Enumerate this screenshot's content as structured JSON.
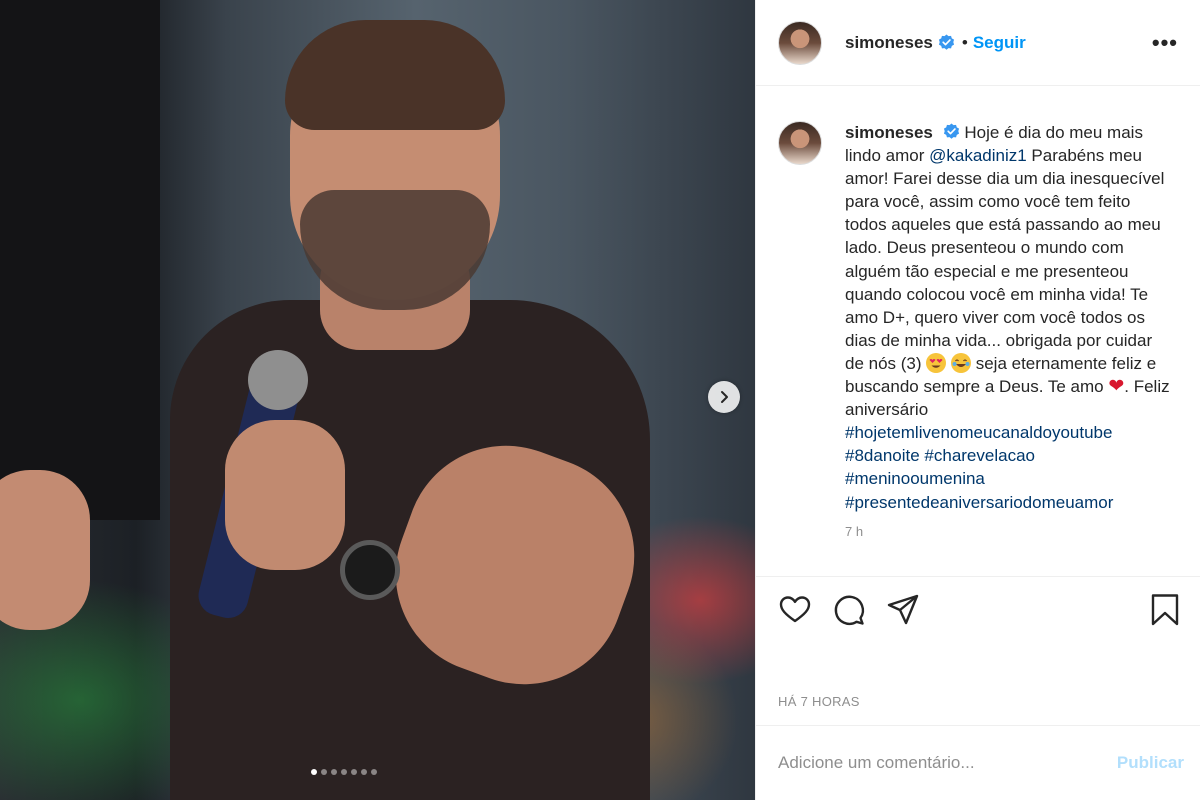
{
  "header": {
    "username": "simoneses",
    "separator": "•",
    "follow_label": "Seguir",
    "more_label": "•••"
  },
  "caption": {
    "username": "simoneses",
    "text_1": "Hoje é dia do meu mais lindo amor ",
    "mention": "@kakadiniz1",
    "text_2": " Parabéns meu amor! Farei desse dia um dia inesquecível para você, assim como você tem feito todos aqueles que está passando ao meu lado. Deus presenteou o mundo com alguém tão especial e me presenteou quando colocou você em minha vida! Te amo D+, quero viver com você todos os dias de minha vida... obrigada por cuidar de nós (3) ",
    "text_3": " seja eternamente feliz e buscando sempre a Deus. Te amo ",
    "text_4": ". Feliz aniversário",
    "hashtags": [
      "#hojetemlivenomeucanaldoyoutube",
      "#8danoite #charevelacao",
      "#meninooumenina",
      "#presentedeaniversariodomeuamor"
    ],
    "time": "7 h"
  },
  "emojis": [
    "heart-eyes-emoji",
    "tears-of-joy-emoji",
    "red-heart-emoji"
  ],
  "carousel": {
    "total": 7,
    "current": 1
  },
  "actions": {
    "like_icon": "heart-icon",
    "comment_icon": "comment-icon",
    "share_icon": "share-icon",
    "save_icon": "bookmark-icon"
  },
  "posted_time": "HÁ 7 HORAS",
  "comment": {
    "placeholder": "Adicione um comentário...",
    "publish_label": "Publicar"
  },
  "colors": {
    "link": "#0095f6",
    "hashtag": "#00376b",
    "publish_disabled": "#b2dffc",
    "verified": "#3897f0"
  }
}
